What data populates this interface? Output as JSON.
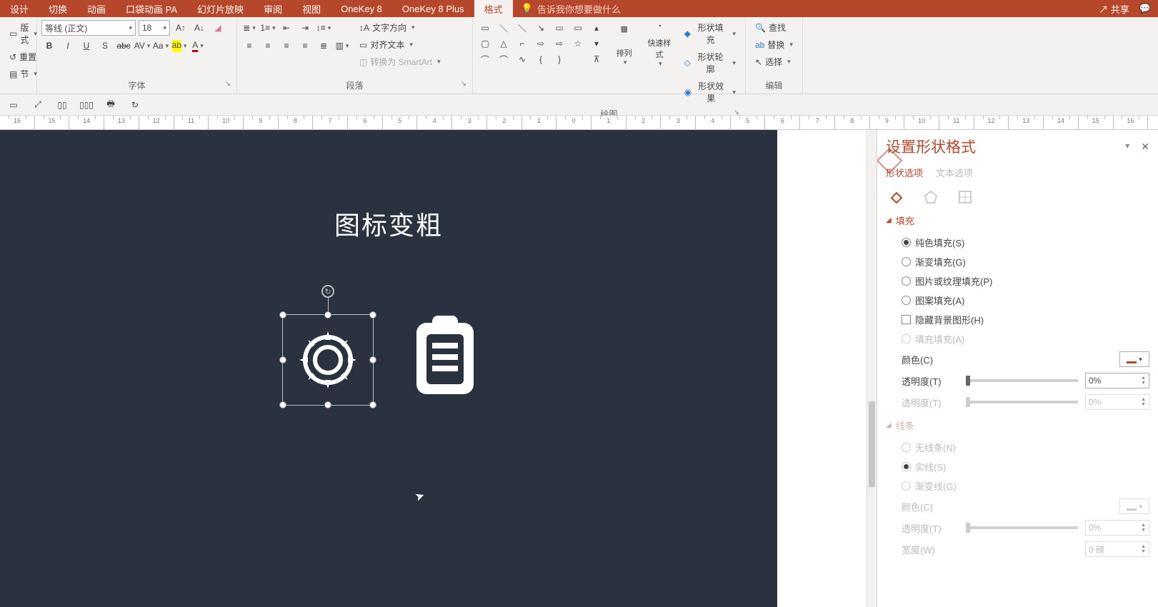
{
  "title_bar": {
    "tabs": [
      "设计",
      "切换",
      "动画",
      "口袋动画 PA",
      "幻灯片放映",
      "审阅",
      "视图",
      "OneKey 8",
      "OneKey 8 Plus",
      "格式"
    ],
    "active_tab_index": 9,
    "tell_me_placeholder": "告诉我你想要做什么",
    "share": "共享"
  },
  "ribbon": {
    "clipboard": {
      "layout": "版式",
      "reset": "重置",
      "section": "节"
    },
    "font": {
      "name": "等线 (正文)",
      "size": "18",
      "label": "字体"
    },
    "paragraph": {
      "text_direction": "文字方向",
      "align_text": "对齐文本",
      "convert_smartart": "转换为 SmartArt",
      "label": "段落"
    },
    "drawing": {
      "arrange": "排列",
      "quick_styles": "快速样式",
      "shape_fill": "形状填充",
      "shape_outline": "形状轮廓",
      "shape_effects": "形状效果",
      "label": "绘图"
    },
    "editing": {
      "find": "查找",
      "replace": "替换",
      "select": "选择",
      "label": "编辑"
    }
  },
  "slide": {
    "title": "图标变粗"
  },
  "ruler_numbers": [
    "16",
    "15",
    "14",
    "13",
    "12",
    "11",
    "10",
    "9",
    "8",
    "7",
    "6",
    "5",
    "4",
    "3",
    "2",
    "1",
    "0",
    "1",
    "2",
    "3",
    "4",
    "5",
    "6",
    "7",
    "8",
    "9",
    "10",
    "11",
    "12",
    "13",
    "14",
    "15",
    "16"
  ],
  "format_pane": {
    "title": "设置形状格式",
    "subtabs": {
      "shape": "形状选项",
      "text": "文本选项"
    },
    "sections": {
      "fill": "填充",
      "line": "线条"
    },
    "fill_opts": {
      "solid": "纯色填充(S)",
      "gradient": "渐变填充(G)",
      "picture": "图片或纹理填充(P)",
      "pattern": "图案填充(A)",
      "hide_bg": "隐藏背景图形(H)",
      "ghost": "填充填充(A)"
    },
    "color_label": "颜色(C)",
    "transparency_label": "透明度(T)",
    "transparency_value": "0%",
    "line_opts": {
      "none": "无线条(N)",
      "solid": "实线(S)",
      "gradient": "渐变线(G)"
    },
    "line_color_label": "颜色(C)",
    "line_transparency_label": "透明度(T)",
    "line_transparency_value": "0%",
    "line_width_label": "宽度(W)",
    "line_width_value": "0 磅"
  }
}
